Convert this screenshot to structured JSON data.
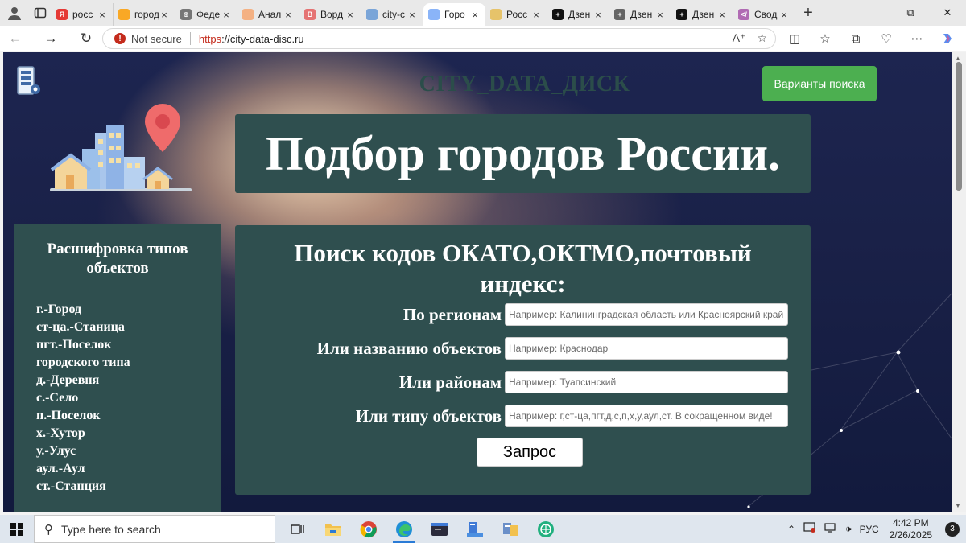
{
  "browser": {
    "tabs": [
      {
        "title": "росс",
        "color": "#e53935",
        "glyph": "Я"
      },
      {
        "title": "город",
        "color": "#f9a825",
        "glyph": ""
      },
      {
        "title": "Феде",
        "color": "#777777",
        "glyph": "⊕"
      },
      {
        "title": "Анал",
        "color": "#f4b183",
        "glyph": ""
      },
      {
        "title": "Ворд",
        "color": "#e57373",
        "glyph": "B"
      },
      {
        "title": "city-c",
        "color": "#7aa5d8",
        "glyph": ""
      },
      {
        "title": "Горо",
        "color": "#8ab4f8",
        "glyph": ""
      },
      {
        "title": "Росс",
        "color": "#e6c36a",
        "glyph": ""
      },
      {
        "title": "Дзен",
        "color": "#111111",
        "glyph": "+"
      },
      {
        "title": "Дзен",
        "color": "#666666",
        "glyph": "+"
      },
      {
        "title": "Дзен",
        "color": "#111111",
        "glyph": "+"
      },
      {
        "title": "Свод",
        "color": "#b06ab3",
        "glyph": "</"
      }
    ],
    "active_tab_index": 6,
    "new_tab_label": "+",
    "security_label": "Not secure",
    "url_scheme": "https",
    "url_rest": "://city-data-disc.ru"
  },
  "page": {
    "site_title": "CITY_DATA_ДИСК",
    "search_variants_button": "Варианты поиска",
    "hero_title": "Подбор городов России.",
    "legend": {
      "title": "Расшифровка типов объектов",
      "items": [
        "г.-Город",
        "ст-ца.-Станица",
        "пгт.-Поселок",
        "городского типа",
        "д.-Деревня",
        "с.-Село",
        "п.-Поселок",
        "х.-Хутор",
        "у.-Улус",
        "аул.-Аул",
        "ст.-Станция"
      ]
    },
    "search": {
      "title": "Поиск кодов ОКАТО,ОКТМО,почтовый индекс:",
      "region_label": "По регионам",
      "region_placeholder": "Например: Калининградская область или Красноярский край",
      "name_label": "Или названию объектов",
      "name_placeholder": "Например: Краснодар",
      "district_label": "Или районам",
      "district_placeholder": "Например: Туапсинский",
      "type_label": "Или типу объектов",
      "type_placeholder": "Например: г,ст-ца,пгт,д,с,п,х,у,аул,ст. В сокращенном виде!",
      "submit_label": "Запрос"
    }
  },
  "taskbar": {
    "search_placeholder": "Type here to search",
    "language": "РУС",
    "time": "4:42 PM",
    "date": "2/26/2025",
    "notification_count": "3"
  }
}
